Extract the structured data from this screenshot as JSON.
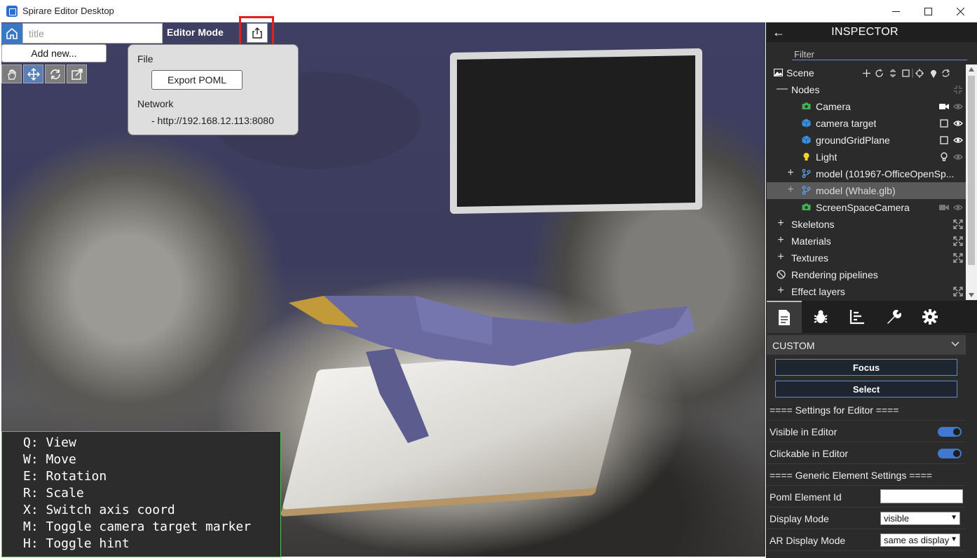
{
  "window": {
    "title": "Spirare Editor Desktop"
  },
  "toolbar": {
    "title_placeholder": "title",
    "editor_mode": "Editor Mode",
    "add_new": "Add new..."
  },
  "export_popup": {
    "file_label": "File",
    "export_button": "Export POML",
    "network_label": "Network",
    "network_url": "- http://192.168.12.113:8080"
  },
  "hints": [
    "Q: View",
    "W: Move",
    "E: Rotation",
    "R: Scale",
    "X: Switch axis coord",
    "M: Toggle camera target marker",
    "H: Toggle hint"
  ],
  "inspector": {
    "title": "INSPECTOR",
    "filter_placeholder": "Filter",
    "tree": [
      {
        "label": "Scene",
        "icon": "image-icon"
      },
      {
        "label": "Nodes",
        "icon": "collapse-icon"
      },
      {
        "label": "Camera",
        "icon": "camera-icon"
      },
      {
        "label": "camera target",
        "icon": "cube-icon"
      },
      {
        "label": "groundGridPlane",
        "icon": "cube-icon"
      },
      {
        "label": "Light",
        "icon": "bulb-icon"
      },
      {
        "label": "model (101967-OfficeOpenSp...",
        "icon": "branch-icon"
      },
      {
        "label": "model (Whale.glb)",
        "icon": "branch-icon"
      },
      {
        "label": "ScreenSpaceCamera",
        "icon": "camera-icon"
      },
      {
        "label": "Skeletons",
        "icon": "plus-icon"
      },
      {
        "label": "Materials",
        "icon": "plus-icon"
      },
      {
        "label": "Textures",
        "icon": "plus-icon"
      },
      {
        "label": "Rendering pipelines",
        "icon": "block-icon"
      },
      {
        "label": "Effect layers",
        "icon": "plus-icon"
      }
    ],
    "custom_section": "CUSTOM",
    "focus_button": "Focus",
    "select_button": "Select",
    "editor_settings_header": "==== Settings for Editor ====",
    "visible_in_editor": "Visible in Editor",
    "clickable_in_editor": "Clickable in Editor",
    "generic_settings_header": "==== Generic Element Settings ====",
    "poml_element_id": "Poml Element Id",
    "display_mode": "Display Mode",
    "display_mode_value": "visible",
    "ar_display_mode": "AR Display Mode",
    "ar_display_mode_value": "same as display"
  },
  "colors": {
    "accent": "#3b78c4",
    "highlight": "#e0201f",
    "inspector_bg": "#2b2b2b",
    "hint_border": "#57c05a"
  }
}
